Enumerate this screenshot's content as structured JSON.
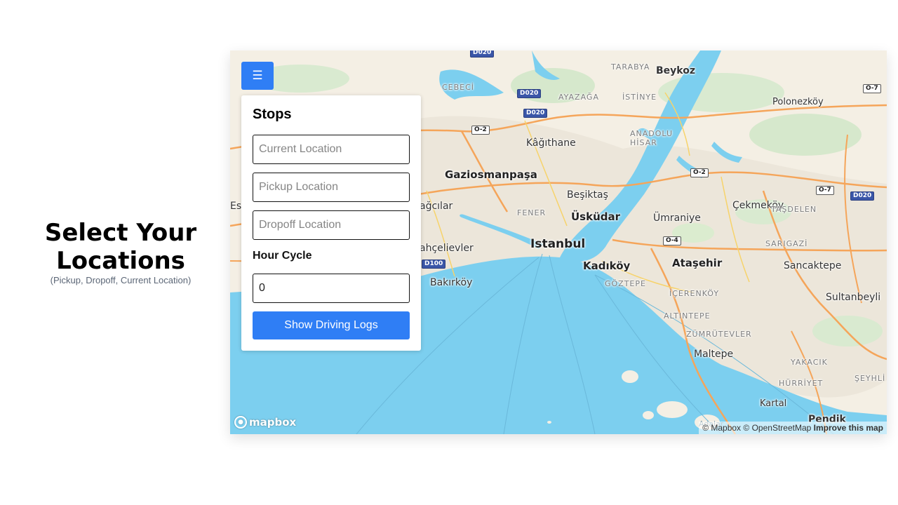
{
  "intro": {
    "title": "Select Your Locations",
    "subtitle": "(Pickup, Dropoff, Current Location)"
  },
  "map": {
    "menu_icon": "hamburger-icon",
    "menu_glyph": "☰",
    "labels": {
      "istanbul": "Istanbul",
      "uskudar": "Üsküdar",
      "kadikoy": "Kadıköy",
      "besiktas": "Beşiktaş",
      "gaziosmanpasa": "Gaziosmanpaşa",
      "kagithane": "Kâğıthane",
      "bagcilar": "ağcılar",
      "bahcelievler": "ahçelievler",
      "bakirkoy": "Bakırköy",
      "umraniye": "Ümraniye",
      "atasehir": "Ataşehir",
      "beykoz": "Beykoz",
      "polonezkoy": "Polonezköy",
      "cekmekoy": "Çekmeköy",
      "sancaktepe": "Sancaktepe",
      "sultanbeyli": "Sultanbeyli",
      "maltepe": "Maltepe",
      "kartal": "Kartal",
      "pendik": "Pendik",
      "es": "Es",
      "tarabya": "TARABYA",
      "cebeci": "CEBECİ",
      "ayazaga": "AYAZAĞA",
      "istinye": "İSTİNYE",
      "anadolu_hisar": "ANADOLU\nHİSAR",
      "fener": "FENER",
      "sarigazi": "SARIGAZİ",
      "tasdelen": "TAŞDELEN",
      "goztepe": "GÖZTEPE",
      "icerenkoy": "İÇERENKÖY",
      "altintepe": "ALTINTEPE",
      "zumrutevler": "ZÜMRÜTEVLER",
      "yakacik": "YAKACIK",
      "hurriyet": "HÜRRİYET",
      "seyhli": "ŞEYHLİ",
      "adalar": "Adalar"
    },
    "shields": {
      "d020_a": "D020",
      "d020_b": "D020",
      "d020_c": "D020",
      "d020_top": "D020",
      "o2_a": "O-2",
      "o2_b": "O-2",
      "o4": "O-4",
      "o7_a": "O-7",
      "o7_b": "O-7",
      "d100": "D100"
    },
    "logo_text": "mapbox",
    "attribution": {
      "mapbox": "© Mapbox",
      "osm": "© OpenStreetMap",
      "improve": "Improve this map"
    },
    "colors": {
      "water": "#7ccfef",
      "land": "#f4efe4",
      "accent": "#2f7ef5"
    }
  },
  "panel": {
    "title": "Stops",
    "current_placeholder": "Current Location",
    "pickup_placeholder": "Pickup Location",
    "dropoff_placeholder": "Dropoff Location",
    "hour_cycle_label": "Hour Cycle",
    "hour_cycle_value": "0",
    "submit_label": "Show Driving Logs"
  }
}
